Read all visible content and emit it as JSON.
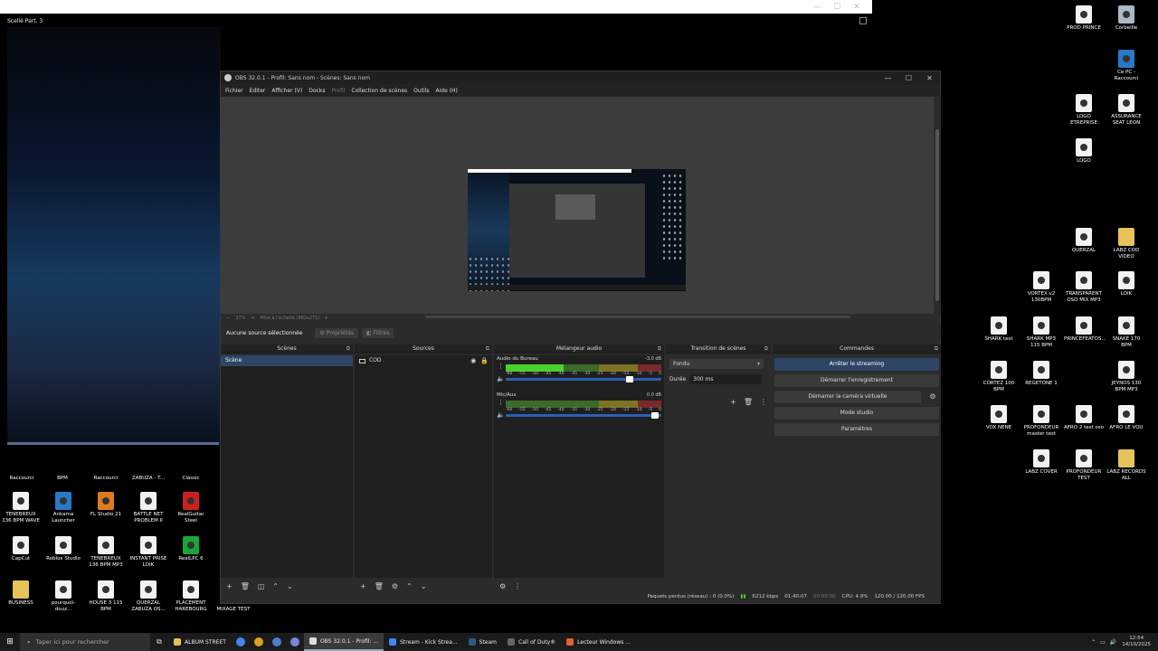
{
  "bg_window": {
    "title": "Scellé Part. 3",
    "controls": [
      "—",
      "☐",
      "✕"
    ]
  },
  "desktop_right": [
    {
      "label": "PROD PRINCE",
      "kind": "doc"
    },
    {
      "label": "Corbeille",
      "kind": "bin"
    },
    {
      "label": "Ce PC - Raccourci",
      "kind": "blue"
    },
    {
      "label": "LOGO ETREPRISE",
      "kind": "doc"
    },
    {
      "label": "ASSURANCE SEAT LEON",
      "kind": "doc"
    },
    {
      "label": "LOGO",
      "kind": "doc"
    },
    {
      "label": "QUERZAL",
      "kind": "doc"
    },
    {
      "label": "LABZ COD VIDEO",
      "kind": "folder"
    },
    {
      "label": "VORTEX v2 130BPM",
      "kind": "doc"
    },
    {
      "label": "TRANSPARENT OSO MIX MP3",
      "kind": "doc"
    },
    {
      "label": "LOIK",
      "kind": "doc"
    },
    {
      "label": "SHARK test",
      "kind": "doc"
    },
    {
      "label": "SHARK MP3 115 BPM",
      "kind": "doc"
    },
    {
      "label": "PRINCEFEATOS...",
      "kind": "doc"
    },
    {
      "label": "SNAKE 170 BPM",
      "kind": "doc"
    },
    {
      "label": "CORTEZ 100 BPM",
      "kind": "doc"
    },
    {
      "label": "REGETONE 1",
      "kind": "doc"
    },
    {
      "label": "JEYNOS 130 BPM MP3",
      "kind": "doc"
    },
    {
      "label": "VOX NENE",
      "kind": "doc"
    },
    {
      "label": "PROFONDEUR master test",
      "kind": "doc"
    },
    {
      "label": "AFRO 2 test oso",
      "kind": "doc"
    },
    {
      "label": "AFRO LE VOU",
      "kind": "doc"
    },
    {
      "label": "LABZ COVER",
      "kind": "doc"
    },
    {
      "label": "PROFONDEUR TEST",
      "kind": "doc"
    },
    {
      "label": "LABZ RECORDS ALL",
      "kind": "folder"
    }
  ],
  "desktop_left_top_labels": [
    "Raccourci",
    "BPM",
    "Raccourci",
    "ZABUZA - T...",
    "Classic"
  ],
  "desktop_left": [
    {
      "label": "TENEBREUX 136 BPM WAVE",
      "kind": "doc"
    },
    {
      "label": "Ankama Launcher",
      "kind": "blue"
    },
    {
      "label": "FL Studio 21",
      "kind": "orange"
    },
    {
      "label": "BATTLE NET PROBLEM II",
      "kind": "doc"
    },
    {
      "label": "RealGuitar Steel",
      "kind": "red"
    },
    {
      "label": "CapCut",
      "kind": "doc"
    },
    {
      "label": "Roblox Studio",
      "kind": "doc"
    },
    {
      "label": "TENEBREUX 136 BPM MP3",
      "kind": "doc"
    },
    {
      "label": "INSTANT PRISE LOIK",
      "kind": "doc"
    },
    {
      "label": "RealLPC 6",
      "kind": "green"
    },
    {
      "label": "BUSINESS",
      "kind": "folder"
    },
    {
      "label": "pourquoi-douz...",
      "kind": "doc"
    },
    {
      "label": "HOUSE 3 115 BPM",
      "kind": "doc"
    },
    {
      "label": "QUERZAL ZABUZA OS...",
      "kind": "doc"
    },
    {
      "label": "PLACEMENT HAREBOURG",
      "kind": "doc"
    },
    {
      "label": "INSTANT MIXAGE TEST",
      "kind": "doc"
    }
  ],
  "obs": {
    "title": "OBS 32.0.1 - Profil: Sans nom - Scènes: Sans nom",
    "menu": [
      "Fichier",
      "Editer",
      "Afficher (V)",
      "Docks",
      "Profil",
      "Collection de scènes",
      "Outils",
      "Aide (H)"
    ],
    "zoom_text": "37%",
    "scale_text": "Mise à l'échelle (482x271)",
    "no_source": "Aucune source sélectionnée",
    "properties_btn": "Propriétés",
    "filters_btn": "Filtres",
    "docks": {
      "scenes": {
        "title": "Scènes",
        "items": [
          "Scène"
        ]
      },
      "sources": {
        "title": "Sources",
        "items": [
          "COD"
        ]
      },
      "mixer": {
        "title": "Mélangeur audio",
        "channels": [
          {
            "name": "Audio du Bureau",
            "db": "-3.0 dB",
            "level": 0.37,
            "volume": 0.82
          },
          {
            "name": "Mic/Aux",
            "db": "0.0 dB",
            "level": 0.0,
            "volume": 0.98
          }
        ],
        "ticks": [
          "-60",
          "-55",
          "-50",
          "-45",
          "-40",
          "-35",
          "-30",
          "-25",
          "-20",
          "-15",
          "-10",
          "-5",
          "0"
        ]
      },
      "transitions": {
        "title": "Transition de scènes",
        "type": "Fondu",
        "duration_label": "Durée",
        "duration": "300 ms"
      },
      "controls": {
        "title": "Commandes",
        "buttons": [
          "Arrêter le streaming",
          "Démarrer l'enregistrement",
          "Démarrer la caméra virtuelle",
          "Mode studio",
          "Paramètres"
        ]
      }
    },
    "status": {
      "dropped": "Paquets perdus (réseau) : 0 (0.0%)",
      "bitrate": "6212 kbps",
      "stream_time": "01:40:07",
      "rec_time": "00:00:00",
      "cpu": "CPU: 4.9%",
      "fps": "120.00 / 120.00 FPS"
    }
  },
  "taskbar": {
    "search_placeholder": "Taper ici pour rechercher",
    "apps": [
      {
        "label": "ALBUM STREET",
        "color": "#e6c25a",
        "active": false
      },
      {
        "label": "OBS 32.0.1 - Profil: ...",
        "color": "#ddd",
        "active": true
      },
      {
        "label": "Stream - Kick Strea...",
        "color": "#4285f4",
        "active": false
      },
      {
        "label": "Steam",
        "color": "#2a5b8a",
        "active": false
      },
      {
        "label": "Call of Duty®",
        "color": "#666",
        "active": false
      },
      {
        "label": "Lecteur Windows ...",
        "color": "#e06030",
        "active": false
      }
    ],
    "time": "12:54",
    "date": "14/10/2025"
  }
}
